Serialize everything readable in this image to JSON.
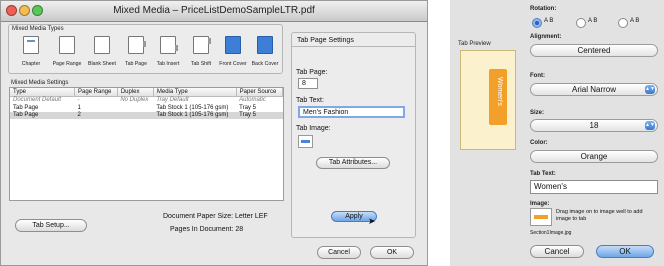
{
  "window": {
    "title": "Mixed Media – PriceListDemoSampleLTR.pdf"
  },
  "media_types": {
    "group_label": "Mixed Media Types",
    "items": [
      {
        "label": "Chapter",
        "icon": "chapter-page-icon"
      },
      {
        "label": "Page Range",
        "icon": "page-range-icon"
      },
      {
        "label": "Blank Sheet",
        "icon": "blank-sheet-icon"
      },
      {
        "label": "Tab Page",
        "icon": "tab-page-icon"
      },
      {
        "label": "Tab Insert",
        "icon": "tab-insert-icon"
      },
      {
        "label": "Tab Shift",
        "icon": "tab-shift-icon"
      },
      {
        "label": "Front Cover",
        "icon": "front-cover-icon"
      },
      {
        "label": "Back Cover",
        "icon": "back-cover-icon"
      }
    ]
  },
  "settings": {
    "group_label": "Mixed Media Settings",
    "columns": [
      "Type",
      "Page Range",
      "Duplex",
      "Media Type",
      "Paper Source"
    ],
    "rows": [
      {
        "type": "Document Default",
        "range": "-",
        "duplex": "No Duplex",
        "media": "Tray Default",
        "source": "Automatic"
      },
      {
        "type": "Tab Page",
        "range": "1",
        "duplex": "",
        "media": "Tab Stock 1 (105-176 gsm)",
        "source": "Tray 5"
      },
      {
        "type": "Tab Page",
        "range": "2",
        "duplex": "",
        "media": "Tab Stock 1 (105-176 gsm)",
        "source": "Tray 5"
      }
    ]
  },
  "tab_setup_label": "Tab Setup...",
  "doc_info": {
    "paper_size": "Document Paper Size: Letter LEF",
    "pages": "Pages In Document: 28"
  },
  "tab_settings": {
    "title": "Tab Page Settings",
    "page_label": "Tab Page:",
    "page_value": "8",
    "text_label": "Tab Text:",
    "text_value": "Men's Fashion",
    "image_label": "Tab Image:",
    "attributes_button": "Tab Attributes...",
    "apply_button": "Apply"
  },
  "dialog_buttons": {
    "cancel": "Cancel",
    "ok": "OK"
  },
  "right_panel": {
    "rotation_label": "Rotation:",
    "rotation_options": [
      "A B",
      "A B",
      "A B"
    ],
    "tab_preview_label": "Tab Preview",
    "preview_tab_text": "Women's",
    "alignment_label": "Alignment:",
    "alignment_value": "Centered",
    "font_label": "Font:",
    "font_value": "Arial Narrow",
    "size_label": "Size:",
    "size_value": "18",
    "color_label": "Color:",
    "color_value": "Orange",
    "tab_text_label": "Tab Text:",
    "tab_text_value": "Women's",
    "image_label": "Image:",
    "image_hint": "Drag image on to image well to add image to tab",
    "image_filename": "Section1Image.jpg",
    "cancel": "Cancel",
    "ok": "OK"
  },
  "colors": {
    "accent": "#4a84d8",
    "tab_orange": "#f2a02a",
    "selection": "#d6d6d6"
  }
}
